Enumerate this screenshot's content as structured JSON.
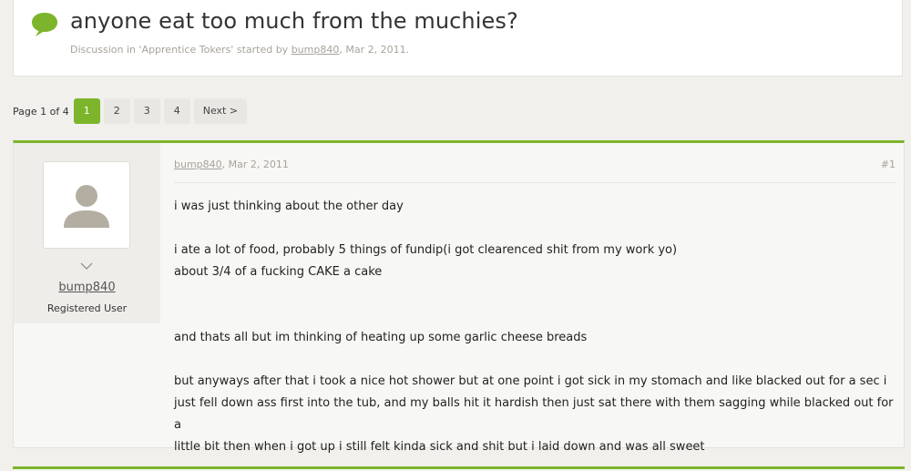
{
  "colors": {
    "accent": "#7cb52c",
    "page_bg": "#f1f0ec"
  },
  "thread": {
    "title": "anyone eat too much from the muchies?",
    "meta_prefix": "Discussion in 'Apprentice Tokers' started by ",
    "author": "bump840",
    "meta_suffix": ", Mar 2, 2011."
  },
  "pagination": {
    "label": "Page 1 of 4",
    "pages": [
      "1",
      "2",
      "3",
      "4"
    ],
    "current": "1",
    "next": "Next >"
  },
  "post": {
    "username": "bump840",
    "user_title": "Registered User",
    "date": "Mar 2, 2011",
    "number": "#1",
    "lines": [
      "i was just thinking about the other day",
      "i ate a lot of food, probably 5 things of fundip(i got clearenced shit from my work yo)",
      "about 3/4 of a fucking CAKE a cake",
      "and thats all but im thinking of heating up some garlic cheese breads",
      "but anyways after that i took a nice hot shower but at one point i got sick in my stomach and like blacked out for a sec i",
      "just fell down ass first into the tub, and my balls hit it hardish then just sat there with them sagging while blacked out for a",
      "little bit then when i got up i still felt kinda sick and shit but i laid down and was all sweet"
    ]
  }
}
